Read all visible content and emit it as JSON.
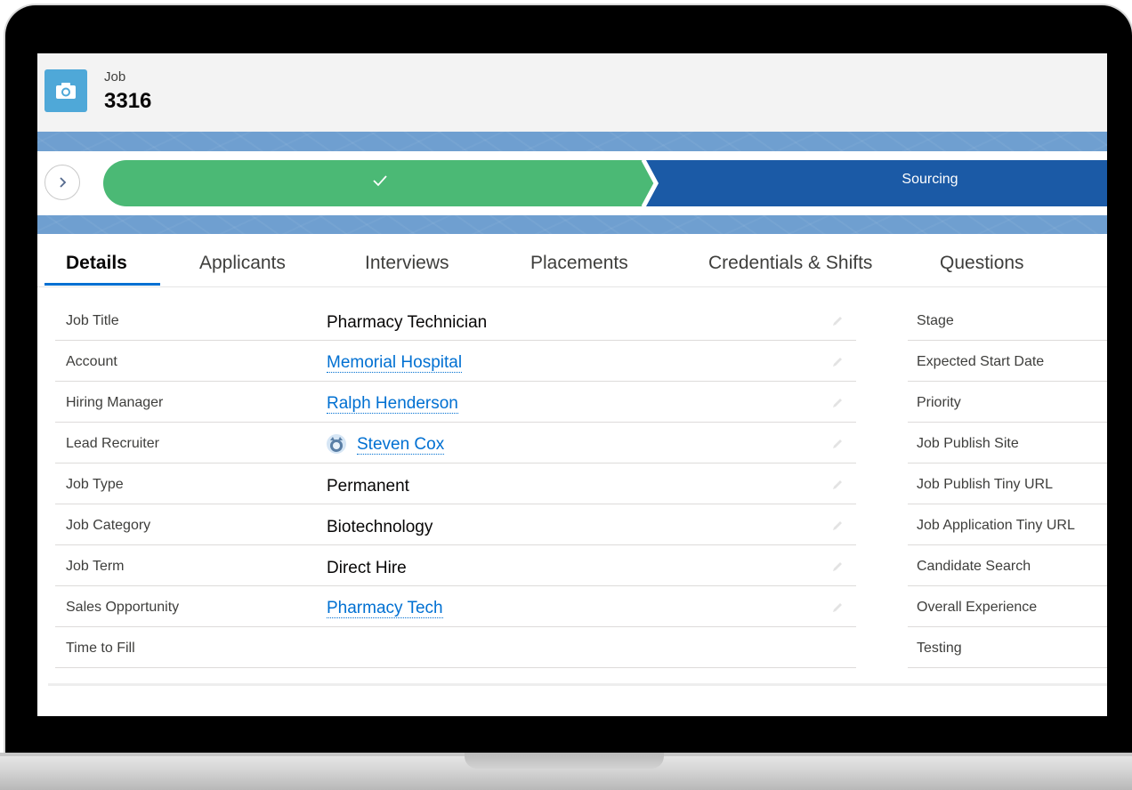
{
  "header": {
    "object_label": "Job",
    "record_name": "3316",
    "object_icon": "camera-icon"
  },
  "path": {
    "completed_stage_icon": "check-icon",
    "current_stage": "Sourcing",
    "completed_color": "#4bb975",
    "current_color": "#1b5aa6"
  },
  "tabs": [
    {
      "label": "Details",
      "active": true
    },
    {
      "label": "Applicants"
    },
    {
      "label": "Interviews"
    },
    {
      "label": "Placements"
    },
    {
      "label": "Credentials & Shifts"
    },
    {
      "label": "Questions"
    }
  ],
  "details": {
    "left": [
      {
        "label": "Job Title",
        "value": "Pharmacy Technician"
      },
      {
        "label": "Account",
        "value": "Memorial Hospital",
        "link": true
      },
      {
        "label": "Hiring Manager",
        "value": "Ralph Henderson",
        "link": true
      },
      {
        "label": "Lead Recruiter",
        "value": "Steven Cox",
        "link": true,
        "avatar": true
      },
      {
        "label": "Job Type",
        "value": "Permanent"
      },
      {
        "label": "Job Category",
        "value": "Biotechnology"
      },
      {
        "label": "Job Term",
        "value": "Direct Hire"
      },
      {
        "label": "Sales Opportunity",
        "value": "Pharmacy Tech",
        "link": true
      },
      {
        "label": "Time to Fill",
        "value": ""
      }
    ],
    "right": [
      {
        "label": "Stage"
      },
      {
        "label": "Expected Start Date"
      },
      {
        "label": "Priority"
      },
      {
        "label": "Job Publish Site"
      },
      {
        "label": "Job Publish Tiny URL"
      },
      {
        "label": "Job Application Tiny URL"
      },
      {
        "label": "Candidate Search"
      },
      {
        "label": "Overall Experience"
      },
      {
        "label": "Testing"
      }
    ]
  },
  "colors": {
    "link": "#0070d2",
    "brand_icon": "#4fa8d8",
    "tab_active_underline": "#0070d2"
  }
}
